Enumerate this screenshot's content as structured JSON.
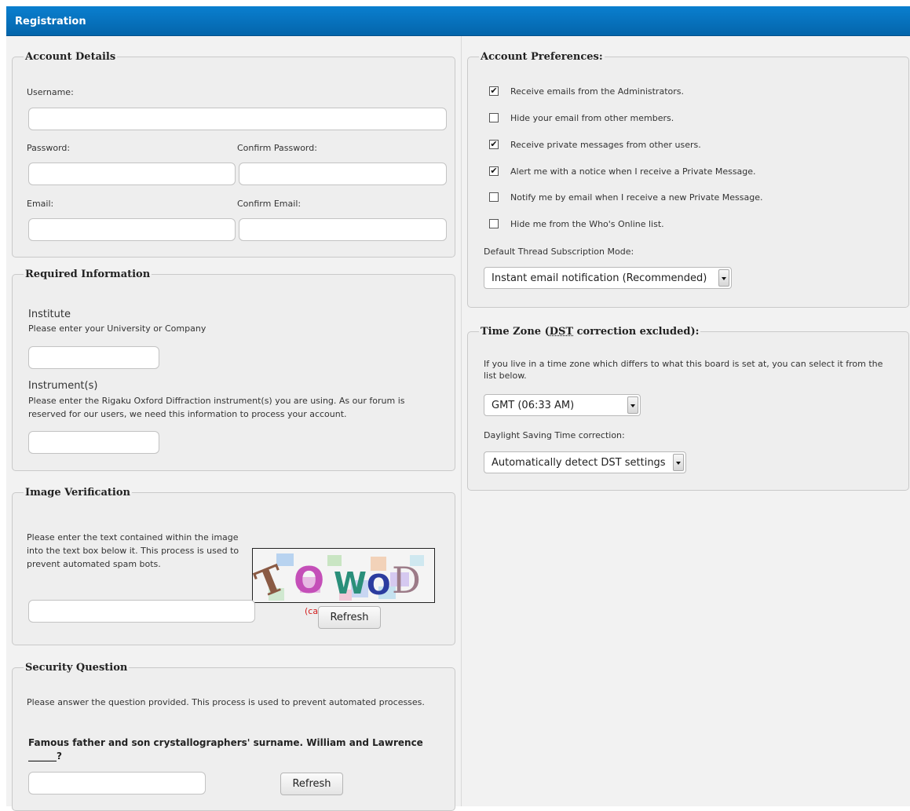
{
  "window": {
    "title": "Registration"
  },
  "account_details": {
    "legend": "Account Details",
    "username_label": "Username:",
    "password_label": "Password:",
    "confirm_password_label": "Confirm Password:",
    "email_label": "Email:",
    "confirm_email_label": "Confirm Email:"
  },
  "required_information": {
    "legend": "Required Information",
    "institute_title": "Institute",
    "institute_help": "Please enter your University or Company",
    "instrument_title": "Instrument(s)",
    "instrument_help_line1": "Please enter the Rigaku Oxford Diffraction instrument(s) you are using. As our forum is",
    "instrument_help_line2": "reserved for our users, we need this information to process your account."
  },
  "image_verification": {
    "legend": "Image Verification",
    "help_line1": "Please enter the text contained within the image",
    "help_line2": "into the text box below it. This process is used to",
    "help_line3": "prevent automated spam bots.",
    "captcha_text": "TOWOD",
    "case_note": "(case insensitive)",
    "refresh_label": "Refresh"
  },
  "security_question": {
    "legend": "Security Question",
    "help": "Please answer the question provided. This process is used to prevent automated processes.",
    "question_line1": "Famous father and son crystallographers' surname. William and Lawrence",
    "question_line2": "______?",
    "refresh_label": "Refresh"
  },
  "account_preferences": {
    "legend": "Account Preferences:",
    "options": [
      {
        "label": "Receive emails from the Administrators.",
        "checked": true,
        "mark": "✔"
      },
      {
        "label": "Hide your email from other members.",
        "checked": false,
        "mark": ""
      },
      {
        "label": "Receive private messages from other users.",
        "checked": true,
        "mark": "✔"
      },
      {
        "label": "Alert me with a notice when I receive a Private Message.",
        "checked": true,
        "mark": "✔"
      },
      {
        "label": "Notify me by email when I receive a new Private Message.",
        "checked": false,
        "mark": ""
      },
      {
        "label": "Hide me from the Who's Online list.",
        "checked": false,
        "mark": ""
      }
    ],
    "subscription_label": "Default Thread Subscription Mode:",
    "subscription_value": "Instant email notification (Recommended)"
  },
  "time_zone": {
    "legend_prefix": "Time Zone (",
    "legend_abbr": "DST",
    "legend_suffix": " correction excluded):",
    "help_line1": "If you live in a time zone which differs to what this board is set at, you can select it from the",
    "help_line2": "list below.",
    "timezone_value": "GMT (06:33 AM)",
    "dst_label": "Daylight Saving Time correction:",
    "dst_value": "Automatically detect DST settings"
  },
  "colors": {
    "titlebar": "#0a7fcf",
    "captcha_note": "#d21b1b"
  }
}
